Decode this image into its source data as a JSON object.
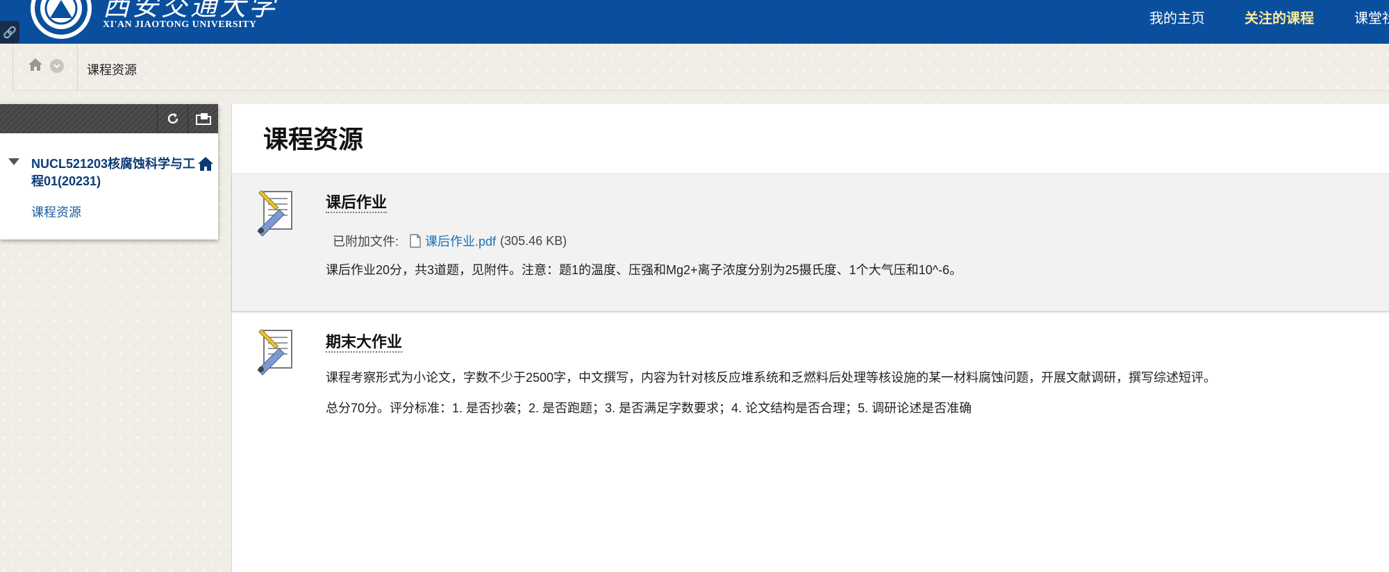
{
  "header": {
    "logo_cn": "西安交通大学",
    "logo_en": "XI'AN JIAOTONG UNIVERSITY",
    "nav": [
      {
        "label": "我的主页",
        "active": false
      },
      {
        "label": "关注的课程",
        "active": true
      },
      {
        "label": "课堂社",
        "active": false
      }
    ],
    "brand_color": "#0a4f9d",
    "active_nav_color": "#ffe99a"
  },
  "breadcrumb": {
    "home_icon": "home-icon",
    "menu_icon": "chevron-down-icon",
    "current": "课程资源"
  },
  "course_menu": {
    "toolbar_icons": [
      "refresh-icon",
      "folder-icon"
    ],
    "course_title": "NUCL521203核腐蚀科学与工程01(20231)",
    "course_home_icon": "home-icon",
    "links": [
      "课程资源"
    ]
  },
  "main": {
    "page_title": "课程资源",
    "items": [
      {
        "icon": "assignment-icon",
        "title": "课后作业",
        "attached_label": "已附加文件:",
        "file_name": "课后作业.pdf",
        "file_size": "(305.46 KB)",
        "description": [
          "课后作业20分，共3道题，见附件。注意：题1的温度、压强和Mg2+离子浓度分别为25摄氏度、1个大气压和10^-6。"
        ]
      },
      {
        "icon": "assignment-icon",
        "title": "期末大作业",
        "description": [
          "课程考察形式为小论文，字数不少于2500字，中文撰写，内容为针对核反应堆系统和乏燃料后处理等核设施的某一材料腐蚀问题，开展文献调研，撰写综述短评。",
          "总分70分。评分标准：1. 是否抄袭；2. 是否跑题；3. 是否满足字数要求；4. 论文结构是否合理；5. 调研论述是否准确"
        ]
      }
    ]
  }
}
